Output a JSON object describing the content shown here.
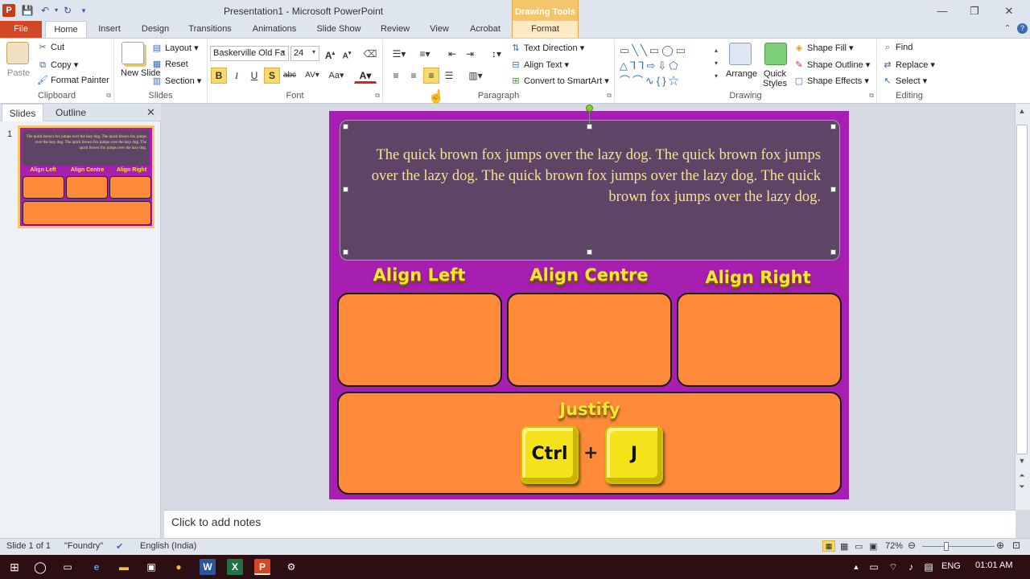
{
  "titlebar": {
    "app_icon": "P",
    "title": "Presentation1  -  Microsoft PowerPoint",
    "contextual_group": "Drawing Tools",
    "qat_icons": [
      "save-icon",
      "undo-icon",
      "redo-icon",
      "customize-qat-icon"
    ]
  },
  "tabs": {
    "file": "File",
    "items": [
      "Home",
      "Insert",
      "Design",
      "Transitions",
      "Animations",
      "Slide Show",
      "Review",
      "View",
      "Acrobat"
    ],
    "format": "Format",
    "active": "Home"
  },
  "ribbon": {
    "clipboard": {
      "label": "Clipboard",
      "paste": "Paste",
      "cut": "Cut",
      "copy": "Copy",
      "format_painter": "Format Painter"
    },
    "slides": {
      "label": "Slides",
      "new_slide": "New Slide",
      "layout": "Layout",
      "reset": "Reset",
      "section": "Section"
    },
    "font": {
      "label": "Font",
      "font_name": "Baskerville Old Fa",
      "font_size": "24",
      "bold": "B",
      "italic": "I",
      "underline": "U",
      "shadow": "S",
      "strike": "abc",
      "spacing": "AV",
      "case": "Aa",
      "color": "A"
    },
    "paragraph": {
      "label": "Paragraph",
      "text_direction": "Text Direction",
      "align_text": "Align Text",
      "convert_smartart": "Convert to SmartArt"
    },
    "drawing": {
      "label": "Drawing",
      "arrange": "Arrange",
      "quick_styles": "Quick Styles",
      "shape_fill": "Shape Fill",
      "shape_outline": "Shape Outline",
      "shape_effects": "Shape Effects"
    },
    "editing": {
      "label": "Editing",
      "find": "Find",
      "replace": "Replace",
      "select": "Select"
    }
  },
  "panel": {
    "tab_slides": "Slides",
    "tab_outline": "Outline",
    "slide_number": "1",
    "thumb_text": "The quick brown fox jumps over the lazy dog. The quick brown fox jumps over the lazy dog. The quick brown fox jumps over the lazy dog. The quick brown fox jumps over the lazy dog.",
    "thumb_h1": "Align Left",
    "thumb_h2": "Align Centre",
    "thumb_h3": "Align Right"
  },
  "slide": {
    "body_text": "The quick brown fox jumps over the lazy dog. The quick brown fox jumps over the lazy dog. The quick brown fox jumps over the lazy dog. The quick brown fox jumps over the lazy dog.",
    "heading_left": "Align Left",
    "heading_centre": "Align Centre",
    "heading_right": "Align Right",
    "heading_justify": "Justify",
    "key1": "Ctrl",
    "plus": "+",
    "key2": "J",
    "bg_color": "#a61fb0",
    "box_color": "#ff8a3a",
    "text_color": "#f6e38c"
  },
  "notes": {
    "placeholder": "Click to add notes"
  },
  "status": {
    "slide_info": "Slide 1 of 1",
    "theme": "\"Foundry\"",
    "language": "English (India)",
    "zoom": "72%"
  },
  "taskbar": {
    "lang": "ENG",
    "time": "01:01 AM"
  }
}
